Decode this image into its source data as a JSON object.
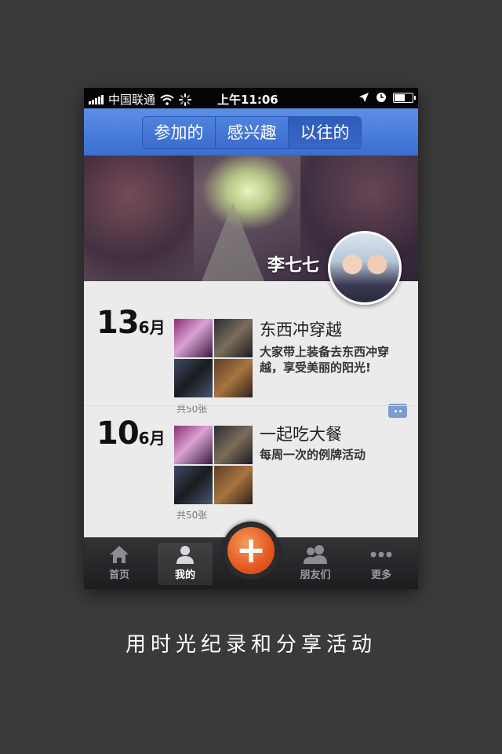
{
  "status_bar": {
    "carrier": "中国联通",
    "time": "上午11:06",
    "battery_level": 0.6
  },
  "segment": {
    "tabs": [
      {
        "label": "参加的"
      },
      {
        "label": "感兴趣"
      },
      {
        "label": "以往的"
      }
    ],
    "active_index": 2
  },
  "profile": {
    "name": "李七七"
  },
  "events": [
    {
      "day": "13",
      "month": "6月",
      "title": "东西冲穿越",
      "description": "大家带上装备去东西冲穿越，享受美丽的阳光!",
      "photo_count": "共50张"
    },
    {
      "day": "10",
      "month": "6月",
      "title": "一起吃大餐",
      "description": "每周一次的例牌活动",
      "photo_count": "共50张"
    }
  ],
  "tabbar": {
    "home": "首页",
    "mine": "我的",
    "plus": "+",
    "friends": "朋友们",
    "more": "更多"
  },
  "slogan": "用时光纪录和分享活动",
  "colors": {
    "accent_blue": "#3a6ed0",
    "plus_orange": "#e4581f"
  }
}
